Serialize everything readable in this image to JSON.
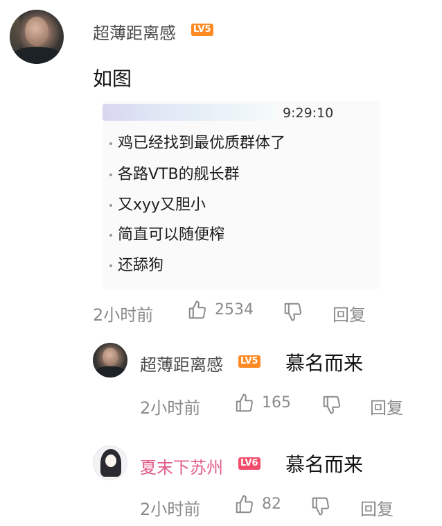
{
  "main_comment": {
    "username": "超薄距离感",
    "level": "LV5",
    "text": "如图",
    "screenshot": {
      "time": "9:29:10",
      "messages": [
        "鸡已经找到最优质群体了",
        "各路VTB的舰长群",
        "又xyy又胆小",
        "简直可以随便榨",
        "还舔狗"
      ]
    },
    "time_ago": "2小时前",
    "likes": "2534",
    "reply_label": "回复"
  },
  "replies": [
    {
      "username": "超薄距离感",
      "level": "LV5",
      "text": "慕名而来",
      "time_ago": "2小时前",
      "likes": "165",
      "reply_label": "回复"
    },
    {
      "username": "夏末下苏州",
      "level": "LV6",
      "text": "慕名而来",
      "time_ago": "2小时前",
      "likes": "82",
      "reply_label": "回复"
    }
  ],
  "colors": {
    "lv5": "#ff8a24",
    "lv6": "#f04d6b",
    "vip_name": "#e25d8b"
  },
  "icons": [
    "thumbs-up-icon",
    "thumbs-down-icon"
  ]
}
